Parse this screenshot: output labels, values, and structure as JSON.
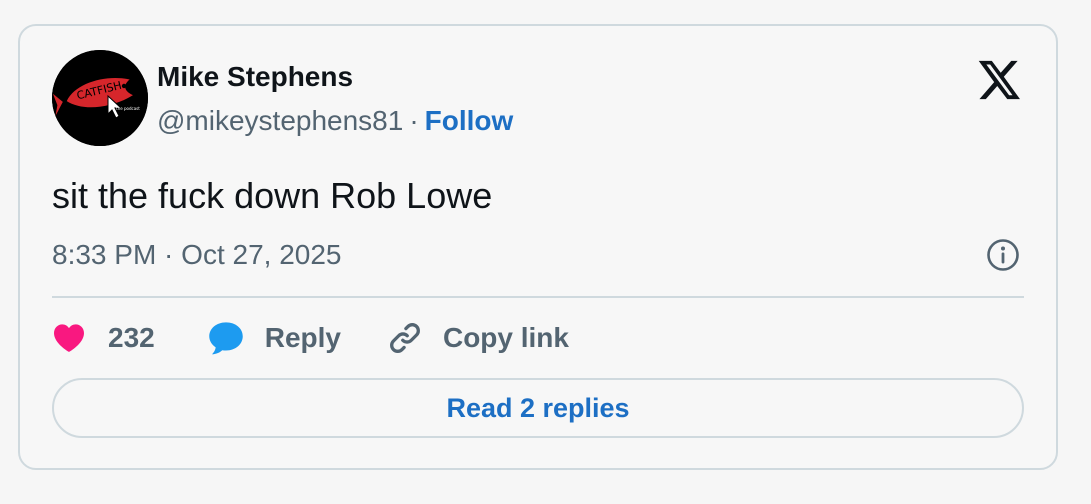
{
  "author": {
    "name": "Mike Stephens",
    "handle": "@mikeystephens81",
    "separator": "·",
    "follow_label": "Follow",
    "avatar_text": "CATFISH",
    "avatar_subtext": "the podcast"
  },
  "tweet": {
    "text": "sit the fuck down Rob Lowe",
    "timestamp": "8:33 PM · Oct 27, 2025"
  },
  "actions": {
    "like_count": "232",
    "reply_label": "Reply",
    "copy_link_label": "Copy link"
  },
  "read_replies_label": "Read 2 replies",
  "icons": {
    "brand": "x-logo-icon",
    "info": "info-icon",
    "like": "heart-icon",
    "reply": "speech-bubble-icon",
    "copy": "link-icon"
  },
  "colors": {
    "like": "#f91880",
    "reply": "#1d9bf0",
    "link_blue": "#1d6fc4",
    "muted": "#536471",
    "avatar_fish": "#d6262b"
  }
}
